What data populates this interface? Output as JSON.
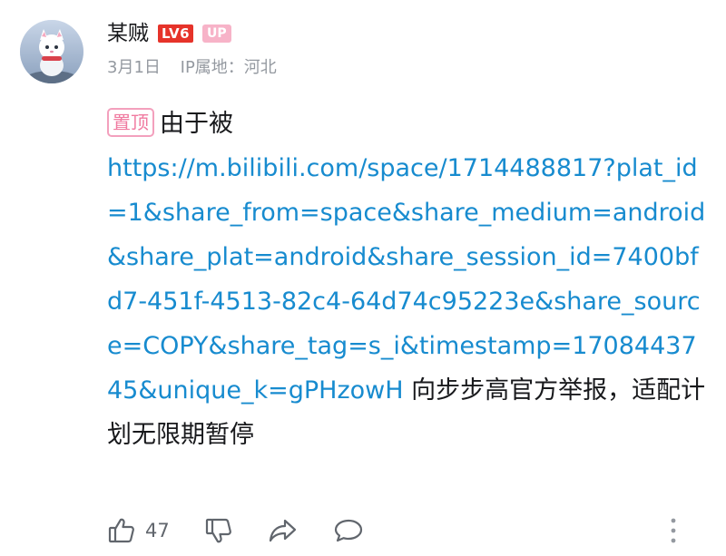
{
  "user": {
    "name": "某贼",
    "level_badge": "LV6",
    "up_badge": "UP",
    "date": "3月1日",
    "ip_location": "IP属地：河北"
  },
  "comment": {
    "pin_tag": "置顶",
    "text_before_link": "由于被",
    "link": "https://m.bilibili.com/space/1714488817?plat_id=1&share_from=space&share_medium=android&share_plat=android&share_session_id=7400bfd7-451f-4513-82c4-64d74c95223e&share_source=COPY&share_tag=s_i&timestamp=1708443745&unique_k=gPHzowH",
    "text_after_link": " 向步步高官方举报，适配计划无限期暂停"
  },
  "actions": {
    "like_icon": "thumbs-up-icon",
    "like_count": "47",
    "dislike_icon": "thumbs-down-icon",
    "share_icon": "share-icon",
    "reply_icon": "reply-bubble-icon",
    "more_icon": "more-vertical-icon"
  },
  "colors": {
    "link": "#178bcf",
    "level_badge_bg": "#e6332a",
    "up_badge_bg": "#f7b3c8",
    "pin_tag": "#f07aa0",
    "meta_text": "#9499a0"
  }
}
